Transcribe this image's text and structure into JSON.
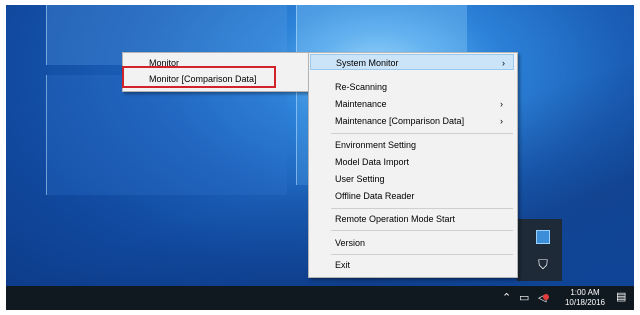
{
  "colors": {
    "highlight": "#cce4f7",
    "annotation_box": "#d0242a",
    "taskbar": "#101820"
  },
  "submenu": {
    "items": [
      {
        "label": "Monitor"
      },
      {
        "label": "Monitor [Comparison Data]"
      }
    ]
  },
  "context_menu": {
    "items": [
      {
        "label": "System Monitor",
        "has_submenu": true,
        "highlighted": true
      },
      {
        "label": "Re-Scanning"
      },
      {
        "label": "Maintenance",
        "has_submenu": true
      },
      {
        "label": "Maintenance [Comparison Data]",
        "has_submenu": true
      },
      {
        "label": "Environment Setting"
      },
      {
        "label": "Model Data Import"
      },
      {
        "label": "User Setting"
      },
      {
        "label": "Offline Data Reader"
      },
      {
        "label": "Remote Operation Mode Start"
      },
      {
        "label": "Version"
      },
      {
        "label": "Exit"
      }
    ],
    "arrow_glyph": "›"
  },
  "taskbar": {
    "time": "1:00 AM",
    "date": "10/18/2016",
    "icons": [
      "chevron-up-icon",
      "network-icon",
      "volume-muted-icon",
      "notification-icon"
    ]
  },
  "tray_flyout": {
    "icons": [
      "app-tray-icon",
      "security-shield-icon"
    ]
  }
}
